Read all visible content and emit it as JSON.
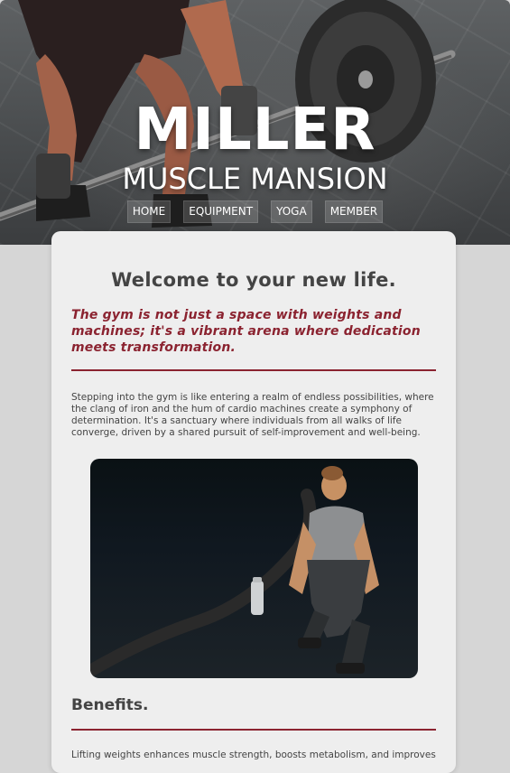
{
  "header": {
    "title": "MILLER",
    "subtitle": "MUSCLE MANSION"
  },
  "nav": {
    "items": [
      {
        "label": "HOME"
      },
      {
        "label": "EQUIPMENT"
      },
      {
        "label": "YOGA"
      },
      {
        "label": "MEMBER"
      }
    ]
  },
  "main": {
    "heading": "Welcome to your new life.",
    "tagline": "The gym is not just a space with weights and machines; it's a vibrant arena where dedication meets transformation.",
    "intro": "Stepping into the gym is like entering a realm of endless possibilities, where the clang of iron and the hum of cardio machines create a symphony of determination. It's a sanctuary where individuals from all walks of life converge, driven by a shared pursuit of self-improvement and well-being.",
    "benefits_heading": "Benefits.",
    "benefits_text": "Lifting weights enhances muscle strength, boosts metabolism, and improves"
  },
  "colors": {
    "accent": "#8b2330",
    "page_bg": "#d6d6d6",
    "card_bg": "#eeeeee",
    "text": "#444444"
  }
}
